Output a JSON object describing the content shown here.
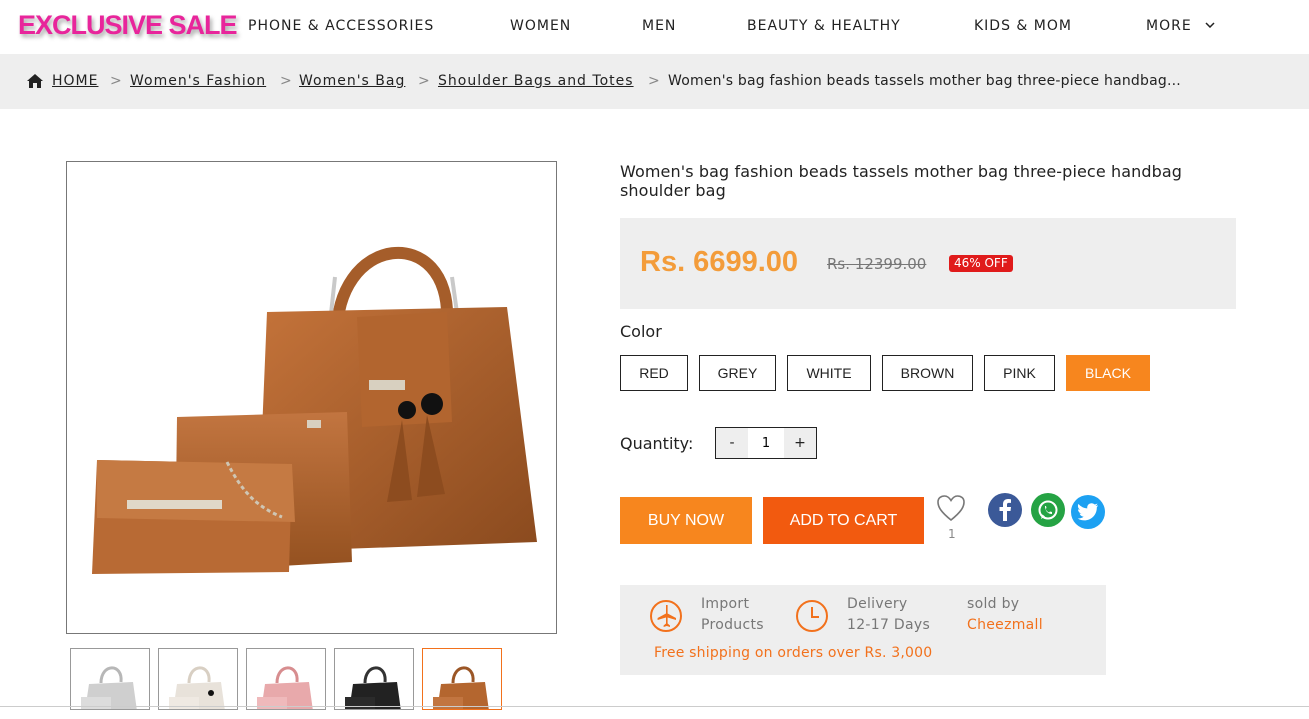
{
  "logo": "EXCLUSIVE SALE",
  "nav": {
    "items": [
      "PHONE & ACCESSORIES",
      "WOMEN",
      "MEN",
      "BEAUTY & HEALTHY",
      "KIDS & MOM",
      "MORE"
    ]
  },
  "breadcrumb": {
    "links": [
      "HOME",
      "Women's Fashion",
      "Women's Bag",
      "Shoulder Bags and Totes"
    ],
    "separator": ">",
    "current": "Women's bag fashion beads tassels mother bag three-piece handbag..."
  },
  "product": {
    "title": "Women's bag fashion beads tassels mother bag three-piece handbag shoulder bag",
    "price": "Rs. 6699.00",
    "old_price": "Rs. 12399.00",
    "discount": "46% OFF",
    "color_label": "Color",
    "colors": [
      "RED",
      "GREY",
      "WHITE",
      "BROWN",
      "PINK",
      "BLACK"
    ],
    "selected_color": "BLACK",
    "quantity_label": "Quantity:",
    "quantity": "1",
    "qty_minus": "-",
    "qty_plus": "+",
    "buy_now": "BUY NOW",
    "add_to_cart": "ADD TO CART",
    "wishlist_count": "1"
  },
  "info": {
    "import_line1": "Import",
    "import_line2": "Products",
    "delivery_line1": "Delivery",
    "delivery_line2": "12-17 Days",
    "sold_by_label": "sold by",
    "seller": "Cheezmall",
    "shipping": "Free shipping on orders over Rs. 3,000"
  },
  "colors": {
    "brand_pink": "#e8259b",
    "accent_orange": "#f7861e",
    "cart_orange": "#f25a0f",
    "price_orange": "#f39c3a",
    "discount_red": "#e01b1b",
    "facebook": "#3b5998",
    "whatsapp": "#25a344",
    "twitter": "#1da1f2"
  },
  "icons": {
    "home": "home-icon",
    "chevron": "chevron-down-icon",
    "heart": "heart-icon",
    "plane": "airplane-icon",
    "clock": "clock-icon"
  }
}
